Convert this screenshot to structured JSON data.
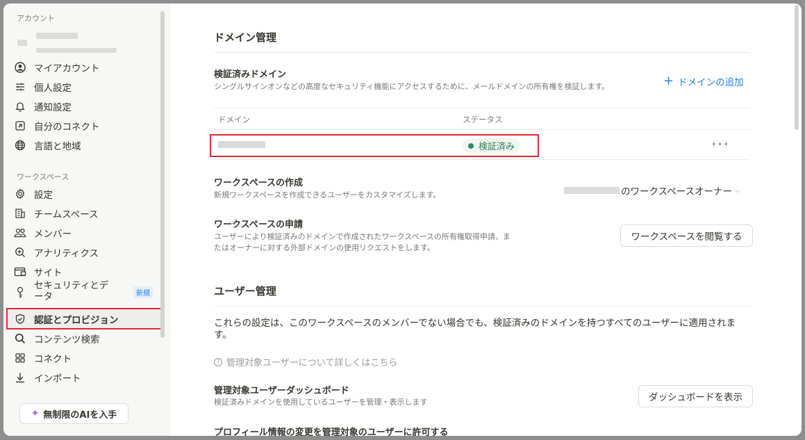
{
  "sidebar": {
    "account_section": "アカウント",
    "account_items": [
      {
        "label": "マイアカウント",
        "icon": "user-circle-icon"
      },
      {
        "label": "個人設定",
        "icon": "sliders-icon"
      },
      {
        "label": "通知設定",
        "icon": "bell-icon"
      },
      {
        "label": "自分のコネクト",
        "icon": "external-link-icon"
      },
      {
        "label": "言語と地域",
        "icon": "globe-icon"
      }
    ],
    "workspace_section": "ワークスペース",
    "workspace_items": [
      {
        "label": "設定",
        "icon": "gear-icon"
      },
      {
        "label": "チームスペース",
        "icon": "building-icon"
      },
      {
        "label": "メンバー",
        "icon": "people-icon"
      },
      {
        "label": "アナリティクス",
        "icon": "analytics-icon"
      },
      {
        "label": "サイト",
        "icon": "site-icon"
      },
      {
        "label": "セキュリティとデータ",
        "icon": "key-icon",
        "badge": "新規"
      },
      {
        "label": "認証とプロビジョン",
        "icon": "shield-check-icon"
      },
      {
        "label": "コンテンツ検索",
        "icon": "search-icon"
      },
      {
        "label": "コネクト",
        "icon": "grid-icon"
      },
      {
        "label": "インポート",
        "icon": "download-icon"
      }
    ],
    "ai_button": "無制限のAIを入手"
  },
  "domain": {
    "heading": "ドメイン管理",
    "verified_title": "検証済みドメイン",
    "verified_desc": "シングルサインオンなどの高度なセキュリティ機能にアクセスするために、メールドメインの所有権を検証します。",
    "add_label": "ドメインの追加",
    "col_domain": "ドメイン",
    "col_status": "ステータス",
    "status": "検証済み",
    "more": "•••"
  },
  "workspace_creation": {
    "title": "ワークスペースの作成",
    "desc": "新規ワークスペースを作成できるユーザーをカスタマイズします。",
    "select_value": "のワークスペースオーナー"
  },
  "workspace_request": {
    "title": "ワークスペースの申請",
    "desc_line1": "ユーザーにより検証済みのドメインで作成されたワークスペースの所有権取得申請、ま",
    "desc_line2": "たはオーナーに対する外部ドメインの使用リクエストをします。",
    "button": "ワークスペースを閲覧する"
  },
  "user_mgmt": {
    "heading": "ユーザー管理",
    "body": "これらの設定は、このワークスペースのメンバーでない場合でも、検証済みのドメインを持つすべてのユーザーに適用されます。",
    "help_link": "管理対象ユーザーについて詳しくはこちら",
    "dashboard_title": "管理対象ユーザーダッシュボード",
    "dashboard_desc": "検証済みドメインを使用しているユーザーを管理・表示します",
    "dashboard_button": "ダッシュボードを表示",
    "profile_title": "プロフィール情報の変更を管理対象のユーザーに許可する"
  }
}
